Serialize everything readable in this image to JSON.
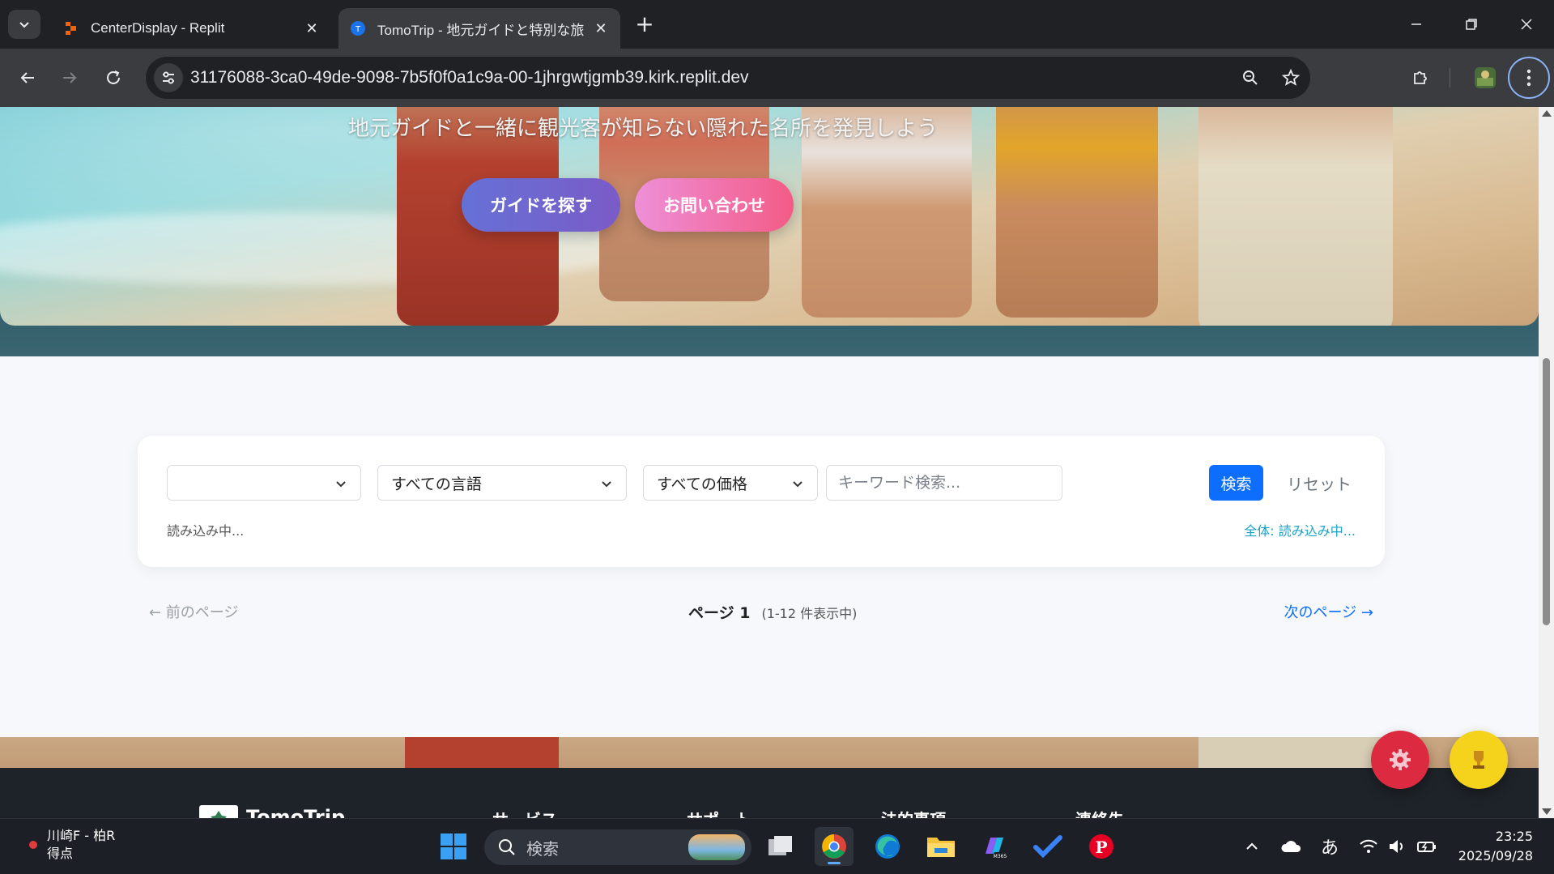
{
  "browser": {
    "tabs": [
      {
        "title": "CenterDisplay - Replit",
        "active": false,
        "favicon": "replit-icon"
      },
      {
        "title": "TomoTrip - 地元ガイドと特別な旅",
        "active": true,
        "favicon": "tomotrip-icon"
      }
    ],
    "url": "31176088-3ca0-49de-9098-7b5f0f0a1c9a-00-1jhrgwtjgmb39.kirk.replit.dev"
  },
  "hero": {
    "subtitle": "地元ガイドと一緒に観光客が知らない隠れた名所を発見しよう",
    "find_guide_label": "ガイドを探す",
    "contact_label": "お問い合わせ"
  },
  "filters": {
    "location_value": "",
    "language_value": "すべての言語",
    "price_value": "すべての価格",
    "keyword_placeholder": "キーワード検索...",
    "search_label": "検索",
    "reset_label": "リセット",
    "loading_left": "読み込み中...",
    "loading_right": "全体: 読み込み中..."
  },
  "pagination": {
    "prev_label": "← 前のページ",
    "page_label": "ページ 1",
    "range_label": "(1-12 件表示中)",
    "next_label": "次のページ →"
  },
  "footer": {
    "brand": "TomoTrip",
    "columns": [
      "サービス",
      "サポート",
      "法的事項",
      "連絡先"
    ]
  },
  "taskbar": {
    "weather_line1": "川崎F - 柏R",
    "weather_line2": "得点",
    "search_label": "検索",
    "ime": "あ",
    "time": "23:25",
    "date": "2025/09/28"
  },
  "colors": {
    "primary_button": "#0d6efd",
    "hero_primary": "#6671d6",
    "hero_secondary": "#f35b86",
    "fab_settings": "#dc2b41",
    "fab_trophy": "#f5d21b"
  }
}
